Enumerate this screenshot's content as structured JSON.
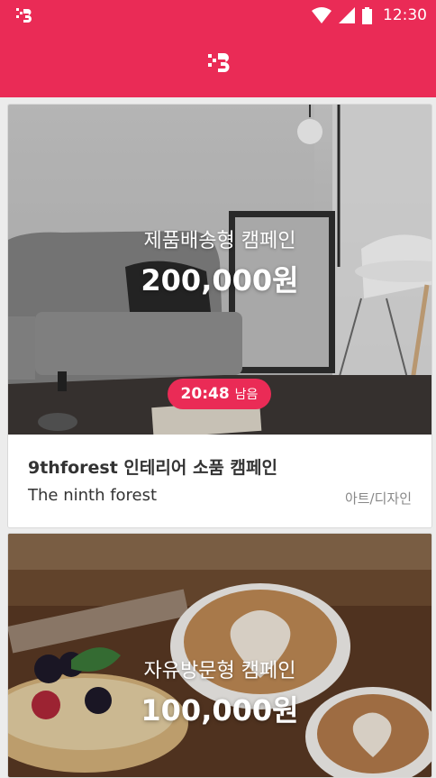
{
  "status_bar": {
    "time": "12:30"
  },
  "colors": {
    "brand": "#ea2b56",
    "timer_badge": "#ea2b56"
  },
  "campaigns": [
    {
      "type": "제품배송형 캠페인",
      "amount": "200,000원",
      "timer": {
        "time": "20:48",
        "label": "남음"
      },
      "title": "9thforest 인테리어 소품 캠페인",
      "brand": "The ninth forest",
      "category": "아트/디자인"
    },
    {
      "type": "자유방문형 캠페인",
      "amount": "100,000원"
    }
  ]
}
